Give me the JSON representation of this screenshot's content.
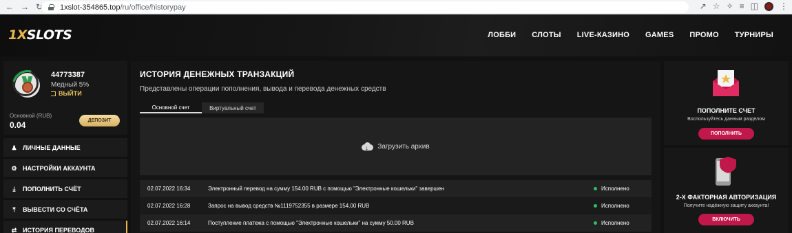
{
  "browser": {
    "url_host": "1xslot-354865.top",
    "url_path": "/ru/office/historypay"
  },
  "header": {
    "logo_num": "1X",
    "logo_text": "SLOTS",
    "nav": [
      "ЛОББИ",
      "СЛОТЫ",
      "LIVE-КАЗИНО",
      "GAMES",
      "ПРОМО",
      "ТУРНИРЫ"
    ]
  },
  "user": {
    "id": "44773387",
    "level": "Медный 5%",
    "logout": "ВЫЙТИ",
    "balance_label": "Основной (RUB)",
    "balance_value": "0.04",
    "deposit": "ДЕПОЗИТ"
  },
  "menu": [
    {
      "label": "ЛИЧНЫЕ ДАННЫЕ",
      "icon": "user-plus-icon"
    },
    {
      "label": "НАСТРОЙКИ АККАУНТА",
      "icon": "gears-icon"
    },
    {
      "label": "ПОПОЛНИТЬ СЧЁТ",
      "icon": "download-icon"
    },
    {
      "label": "ВЫВЕСТИ СО СЧЁТА",
      "icon": "upload-icon"
    },
    {
      "label": "ИСТОРИЯ ПЕРЕВОДОВ",
      "icon": "transfer-icon"
    }
  ],
  "main": {
    "title": "ИСТОРИЯ ДЕНЕЖНЫХ ТРАНЗАКЦИЙ",
    "subtitle": "Представлены операции пополнения, вывода и перевода денежных средств",
    "tabs": [
      "Основной счет",
      "Виртуальный счет"
    ],
    "archive": "Загрузить архив",
    "transactions": [
      {
        "date": "02.07.2022 16:34",
        "desc": "Электронный перевод на сумму 154.00 RUB с помощью \"Электронные кошельки\" завершен",
        "status": "Исполнено"
      },
      {
        "date": "02.07.2022 16:28",
        "desc": "Запрос на вывод средств №1119752355 в размере 154.00 RUB",
        "status": "Исполнено"
      },
      {
        "date": "02.07.2022 16:14",
        "desc": "Поступление платежа с помощью \"Электронные кошельки\" на сумму 50.00 RUB",
        "status": "Исполнено"
      }
    ]
  },
  "right": {
    "topup_title": "ПОПОЛНИТЕ СЧЕТ",
    "topup_sub": "Воспользуйтесь данным разделом",
    "topup_btn": "ПОПОЛНИТЬ",
    "twofa_title": "2-Х ФАКТОРНАЯ АВТОРИЗАЦИЯ",
    "twofa_sub": "Получите надёжную защиту аккаунта!",
    "twofa_btn": "ВКЛЮЧИТЬ"
  },
  "colors": {
    "accent_gold": "#e8b94a",
    "button_red": "#c0184b",
    "status_green": "#2fbf63"
  }
}
